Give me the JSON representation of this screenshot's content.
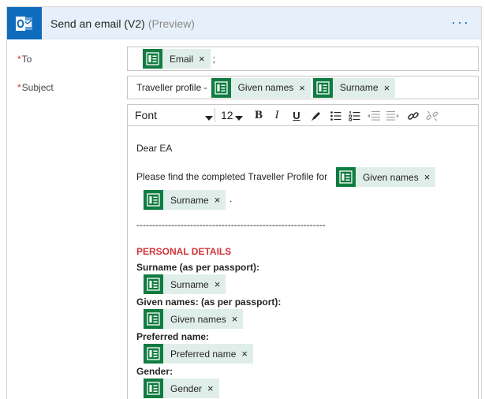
{
  "header": {
    "title": "Send an email (V2)",
    "badge": "(Preview)",
    "more_label": "···",
    "app_icon": "outlook-icon",
    "accent": "#0f6cbd"
  },
  "fields": {
    "to_label": "To",
    "subject_label": "Subject",
    "required_marker": "*"
  },
  "to": {
    "tokens": [
      {
        "label": "Email",
        "icon": "forms-icon"
      }
    ],
    "separator": ";"
  },
  "subject": {
    "prefix": "Traveller profile -",
    "tokens": [
      {
        "label": "Given names",
        "icon": "forms-icon"
      },
      {
        "label": "Surname",
        "icon": "forms-icon"
      }
    ]
  },
  "toolbar": {
    "font": "Font",
    "size": "12",
    "bold": "B",
    "italic": "I",
    "underline": "U",
    "buttons": [
      "pen-icon",
      "bulleted-list-icon",
      "numbered-list-icon",
      "decrease-indent-icon",
      "increase-indent-icon",
      "link-icon",
      "unlink-icon"
    ]
  },
  "body": {
    "greeting": "Dear EA",
    "intro": "Please find the completed Traveller Profile for",
    "intro_tokens": [
      {
        "label": "Given names"
      },
      {
        "label": "Surname"
      }
    ],
    "period": ".",
    "divider": "------------------------------------------------------------",
    "section_title": "PERSONAL DETAILS",
    "fields": [
      {
        "label": "Surname (as per passport):",
        "token": "Surname"
      },
      {
        "label": "Given names: (as per passport):",
        "token": "Given names"
      },
      {
        "label": "Preferred name:",
        "token": "Preferred name"
      },
      {
        "label": "Gender:",
        "token": "Gender"
      }
    ]
  },
  "token_close": "×",
  "colors": {
    "token_bg": "#dfeee9",
    "token_icon": "#107c41",
    "required": "#d13438",
    "section": "#d13438",
    "header_bg": "#e7f0fa"
  }
}
